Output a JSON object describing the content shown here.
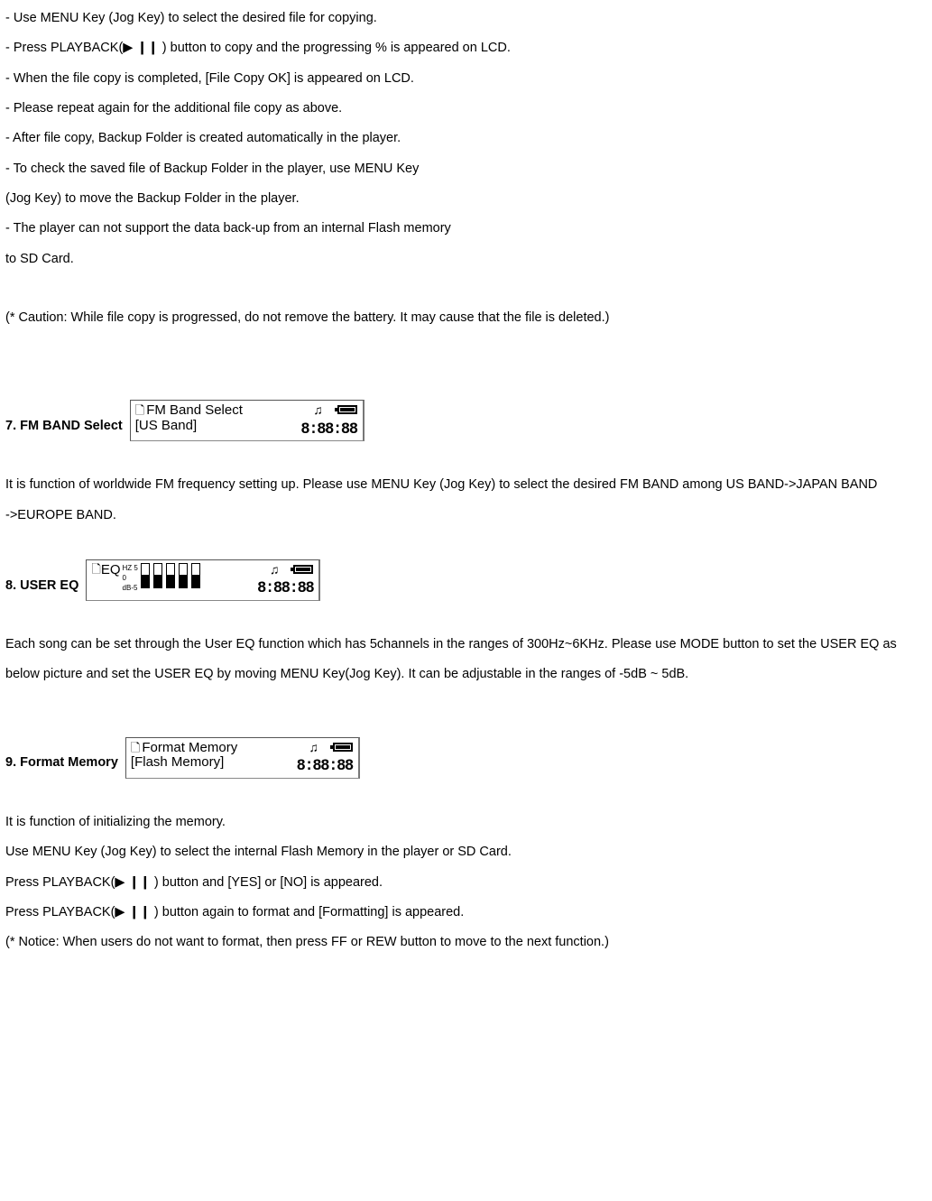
{
  "instructions": [
    "-  Use MENU Key (Jog Key) to select the desired file for copying.",
    "-  Press PLAYBACK(▶ ❙❙ ) button to copy and the progressing % is appeared on LCD.",
    "-  When the file copy is completed, [File Copy OK] is appeared on LCD.",
    "-  Please repeat again for the additional file copy as above.",
    "-  After file copy, Backup Folder is created automatically in the player.",
    "-  To check the saved file of Backup Folder in the player, use MENU Key",
    "   (Jog Key) to move the Backup Folder in the player.",
    "-  The player can not support the data back-up from an internal Flash memory",
    "    to SD Card."
  ],
  "caution": "(* Caution: While file copy is progressed, do not remove the battery.  It may cause that the file is deleted.)",
  "section7": {
    "heading": "7. FM BAND Select",
    "lcd": {
      "title": "FM Band Select",
      "sub": "[US Band]",
      "time": "8:88:88"
    },
    "body1": "It is function of worldwide FM frequency setting up.  Please use MENU Key (Jog Key) to select the desired FM BAND among US BAND->JAPAN BAND",
    "body2": "->EUROPE BAND."
  },
  "section8": {
    "heading": "8. USER EQ",
    "lcd": {
      "title": "EQ",
      "time": "8:88:88",
      "left_top": "HZ 5",
      "left_mid": "0",
      "left_bot": "dB-5"
    },
    "body": "Each song can be set through the User EQ function which has 5channels in the ranges of 300Hz~6KHz.  Please use MODE button to set the USER EQ as below picture and set the USER EQ by moving MENU Key(Jog Key).  It can be adjustable in the ranges of -5dB ~ 5dB."
  },
  "section9": {
    "heading": "9. Format Memory",
    "lcd": {
      "title": "Format Memory",
      "sub": "[Flash Memory]",
      "time": "8:88:88"
    },
    "body": [
      "It is function of initializing the memory.",
      "Use MENU Key (Jog Key) to select the internal Flash Memory in the player or SD Card.",
      "Press PLAYBACK(▶ ❙❙ ) button and [YES] or [NO] is appeared.",
      "Press PLAYBACK(▶ ❙❙ ) button again to format and [Formatting] is appeared.",
      "(* Notice: When users do not want to format, then press FF or REW button to move to the next function.)"
    ]
  }
}
